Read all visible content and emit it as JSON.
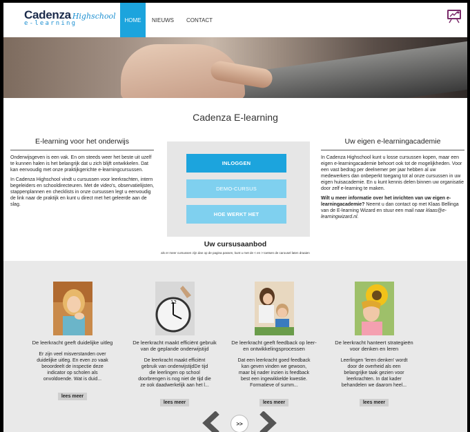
{
  "brand": {
    "name": "Cadenza",
    "script": "Highschool",
    "sub": "e-learning"
  },
  "nav": {
    "items": [
      {
        "label": "HOME",
        "active": true
      },
      {
        "label": "NIEUWS",
        "active": false
      },
      {
        "label": "CONTACT",
        "active": false
      }
    ]
  },
  "header_icon": "wizard-screen-icon",
  "site_title": "Cadenza  E-learning",
  "left": {
    "heading": "E-learning voor het onderwijs",
    "p1": "Onderwijsgeven is een vak. En om steeds weer het beste uit uzelf te kunnen halen is het belangrijk dat u zich blijft ontwikkelen. Dat kan eenvoudig met onze praktijkgerichte e-learningcursussen.",
    "p2": "In Cadenza Highschool vindt u cursussen voor leerkrachten, intern begeleiders en schooldirecteuren. Met de video's, observatielijsten, stappenplannen en checklists in onze cursussen legt u eenvoudig de link naar de praktijk en kunt u direct met het geleerde aan de slag."
  },
  "buttons": {
    "login": "INLOGGEN",
    "demo": "DEMO-CURSUS",
    "how": "HOE WERKT HET"
  },
  "right": {
    "heading": "Uw eigen e-learningacademie",
    "p1": "In Cadenza Highschool kunt u losse cursussen kopen, maar een eigen e-learningacademie behoort ook tot de mogelijkheden. Voor een vast bedrag per deelnemer per jaar hebben al uw medewerkers dan onbeperkt toegang tot al onze cursussen in uw eigen huisacademie. En u kunt kennis delen binnen uw organisatie door zelf e-learning te maken.",
    "p2_bold": "Wilt u meer informatie over het inrichten van uw eigen e-learningacademie?",
    "p2_rest": " Neemt u dan contact op met Klaas Bellinga van de E-learning Wizard en stuur een mail naar ",
    "email": "klaas@e-learningwizard.nl."
  },
  "aanbod": {
    "title": "Uw cursusaanbod",
    "subtitle": "als er meer cursussen zijn dan op de pagina passen, kunt u met de < en > toetsen de carousel laten draaien"
  },
  "cards": [
    {
      "title": "De leerkracht geeft duidelijke uitleg",
      "text": "Er zijn veel misverstanden over duidelijke uitleg. En even zo vaak beoordeelt de inspectie deze indicator op scholen als onvoldoende. Wat is duid...",
      "more": "lees meer"
    },
    {
      "title": "De leerkracht maakt efficiënt gebruik van de geplande onderwijstijd",
      "text": "De leerkracht maakt efficiënt gebruik van onderwijstijdDe tijd die leerlingen op school doorbrengen is nog niet de tijd die ze ook daadwerkelijk aan het l...",
      "more": "lees meer"
    },
    {
      "title": "De leerkracht geeft feedback op leer- en ontwikkelingsprocessen",
      "text": "Dat een leerkracht goed feedback kan geven vinden we gewoon, maar bij nader inzien is feedback best een ingewikkelde kwestie. Formatieve of summ...",
      "more": "lees meer"
    },
    {
      "title": "De leerkracht hanteert strategieën voor denken en leren",
      "text": "Leerlingen 'leren denken' wordt door de overheid als een belangrijke taak gezien voor leerkrachten. In dat kader behandelen we daarom heel...",
      "more": "lees meer"
    }
  ],
  "carousel": {
    "play_label": ">>"
  }
}
